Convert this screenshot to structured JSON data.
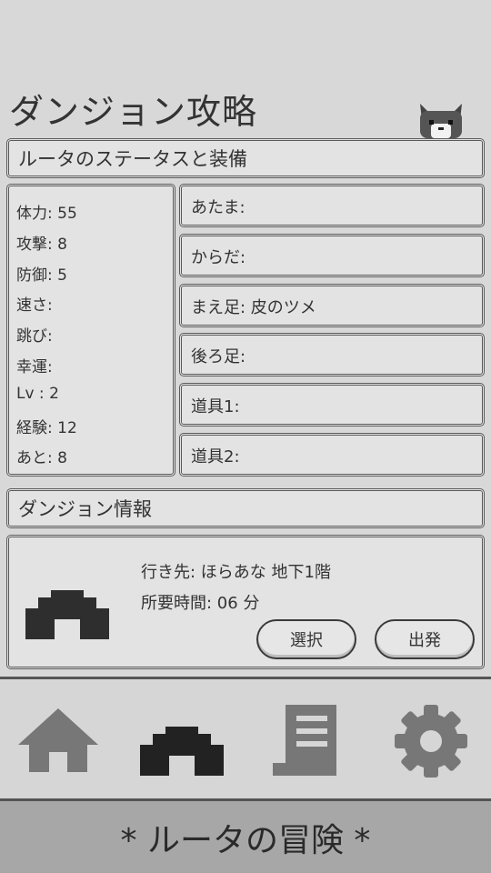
{
  "title": "ダンジョン攻略",
  "status_header": "ルータのステータスと装備",
  "stats": [
    {
      "label": "体力: 55"
    },
    {
      "label": "攻撃: 8"
    },
    {
      "label": "防御: 5"
    },
    {
      "label": "速さ:"
    },
    {
      "label": "跳び:"
    },
    {
      "label": "幸運:"
    },
    {
      "label": "Lv  : 2"
    },
    {
      "label": "経験: 12"
    },
    {
      "label": "あと: 8"
    }
  ],
  "equipment": [
    {
      "label": "あたま:"
    },
    {
      "label": "からだ:"
    },
    {
      "label": "まえ足: 皮のツメ"
    },
    {
      "label": "後ろ足:"
    },
    {
      "label": "道具1:"
    },
    {
      "label": "道具2:"
    }
  ],
  "dungeon_header": "ダンジョン情報",
  "dungeon": {
    "destination": "行き先: ほらあな 地下1階",
    "time_required": "所要時間: 06 分",
    "select_label": "選択",
    "depart_label": "出発"
  },
  "nav": {
    "items": [
      {
        "icon": "home-icon",
        "active": false
      },
      {
        "icon": "dungeon-icon",
        "active": true
      },
      {
        "icon": "scroll-icon",
        "active": false
      },
      {
        "icon": "gear-icon",
        "active": false
      }
    ]
  },
  "footer_title": "* ルータの冒険 *",
  "colors": {
    "background": "#d8d8d8",
    "panel": "#e3e3e3",
    "border": "#5a5a5a",
    "nav_inactive": "#777777",
    "nav_active": "#222222",
    "footer": "#a7a7a7"
  }
}
